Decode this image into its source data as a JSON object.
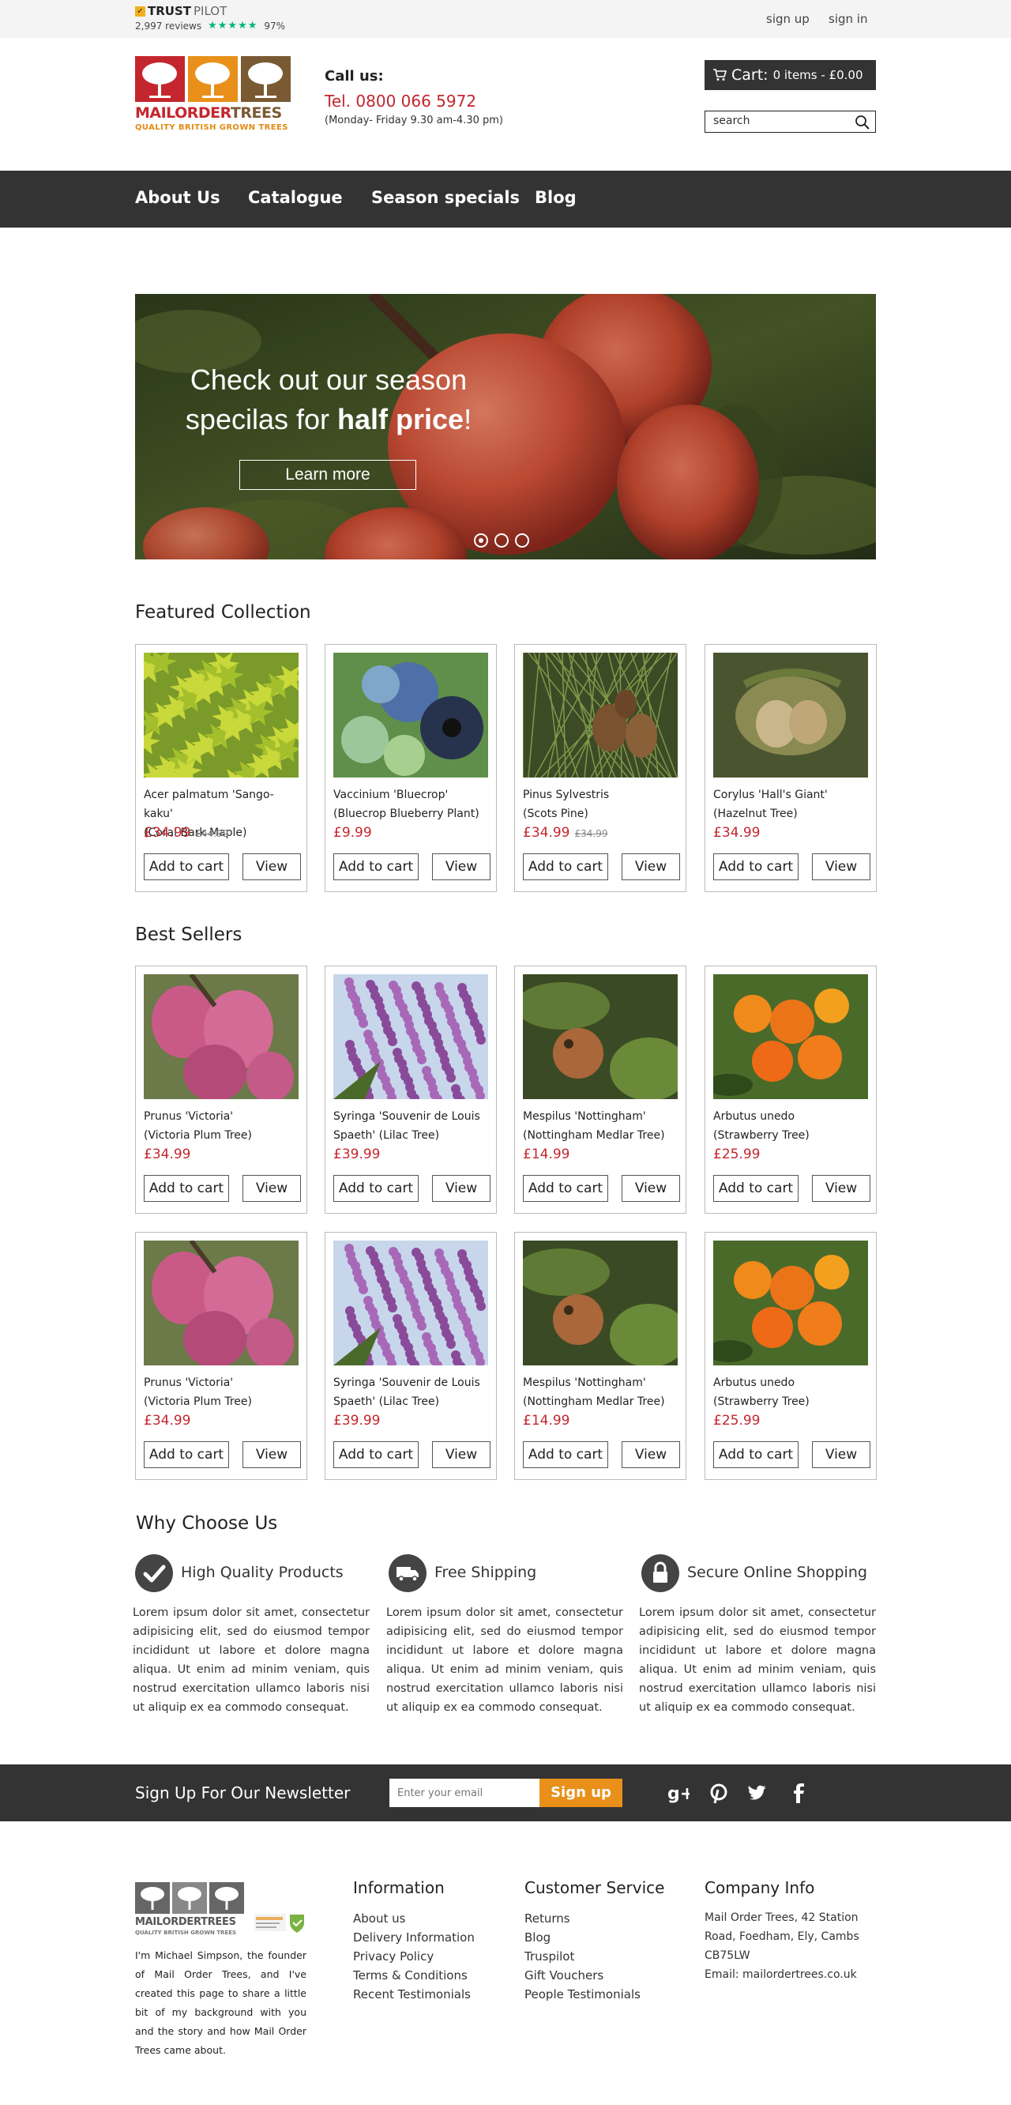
{
  "topbar": {
    "trustpilot_brand": "TRUST",
    "trustpilot_brand_light": "PILOT",
    "reviews": "2,997 reviews",
    "stars": "★★★★★",
    "rating": "97%",
    "signup": "sign up",
    "signin": "sign in"
  },
  "header": {
    "logo_mail": "MAILORDER",
    "logo_trees": "TREES",
    "logo_tagline": "QUALITY BRITISH GROWN TREES",
    "call_label": "Call us:",
    "phone": "Tel. 0800 066 5972",
    "hours": "(Monday- Friday 9.30 am-4.30 pm)",
    "cart_label": "Cart:",
    "cart_summary": "0 items - £0.00",
    "search_value": "search"
  },
  "nav": [
    "About Us",
    "Catalogue",
    "Season specials",
    "Blog"
  ],
  "hero": {
    "line1": "Check out our season",
    "line2_pre": "specilas for ",
    "line2_bold": "half price",
    "line2_post": "!",
    "cta": "Learn more",
    "slides": 3,
    "active_slide": 1
  },
  "featured": {
    "title": "Featured Collection",
    "products": [
      {
        "name1": "Acer palmatum 'Sango-kaku'",
        "name2": " (Coral Bark Maple)",
        "price": "£34.99",
        "old_price": "£44.99",
        "image": "acer"
      },
      {
        "name1": "Vaccinium 'Bluecrop'",
        "name2": "(Bluecrop Blueberry Plant)",
        "price": "£9.99",
        "old_price": "",
        "image": "blueberry"
      },
      {
        "name1": "Pinus Sylvestris",
        "name2": "(Scots Pine)",
        "price": " £34.99",
        "old_price": "£34.99",
        "image": "pine"
      },
      {
        "name1": "Corylus 'Hall's Giant'",
        "name2": "(Hazelnut Tree)",
        "price": " £34.99",
        "old_price": "",
        "image": "hazel"
      }
    ]
  },
  "bestsellers": {
    "title": "Best Sellers",
    "products": [
      {
        "name1": "Prunus 'Victoria'",
        "name2": "(Victoria Plum Tree)",
        "price": "£34.99",
        "old_price": "",
        "image": "plum"
      },
      {
        "name1": "Syringa 'Souvenir de Louis",
        "name2": "Spaeth' (Lilac Tree)",
        "price": "£39.99",
        "old_price": "",
        "image": "lilac"
      },
      {
        "name1": "Mespilus 'Nottingham'",
        "name2": "(Nottingham Medlar Tree)",
        "price": "£14.99",
        "old_price": "",
        "image": "medlar"
      },
      {
        "name1": "Arbutus unedo",
        "name2": "(Strawberry Tree)",
        "price": "£25.99",
        "old_price": "",
        "image": "arbutus"
      },
      {
        "name1": "Prunus 'Victoria'",
        "name2": "(Victoria Plum Tree)",
        "price": "£34.99",
        "old_price": "",
        "image": "plum"
      },
      {
        "name1": "Syringa 'Souvenir de Louis",
        "name2": "Spaeth' (Lilac Tree)",
        "price": "£39.99",
        "old_price": "",
        "image": "lilac"
      },
      {
        "name1": "Mespilus 'Nottingham'",
        "name2": "(Nottingham Medlar Tree)",
        "price": "£14.99",
        "old_price": "",
        "image": "medlar"
      },
      {
        "name1": "Arbutus unedo",
        "name2": "(Strawberry Tree)",
        "price": "£25.99",
        "old_price": "",
        "image": "arbutus"
      }
    ]
  },
  "buttons": {
    "add": "Add to cart",
    "view": "View"
  },
  "why": {
    "title": "Why Choose Us",
    "features": [
      {
        "icon": "check-icon",
        "title": "High Quality Products",
        "text": "Lorem ipsum dolor sit amet, consectetur adipisicing elit, sed do eiusmod tempor incididunt ut labore et dolore magna aliqua. Ut enim ad minim veniam, quis nostrud exercitation ullamco laboris nisi ut aliquip ex ea commodo consequat."
      },
      {
        "icon": "truck-icon",
        "title": "Free Shipping",
        "text": "Lorem ipsum dolor sit amet, consectetur adipisicing elit, sed do eiusmod tempor incididunt ut labore et dolore magna aliqua. Ut enim ad minim veniam, quis nostrud exercitation ullamco laboris nisi ut aliquip ex ea commodo consequat."
      },
      {
        "icon": "lock-icon",
        "title": "Secure Online Shopping",
        "text": "Lorem ipsum dolor sit amet, consectetur adipisicing elit, sed do eiusmod tempor incididunt ut labore et dolore magna aliqua. Ut enim ad minim veniam, quis nostrud exercitation ullamco laboris nisi ut aliquip ex ea commodo consequat."
      }
    ]
  },
  "newsletter": {
    "title": "Sign Up For Our Newsletter",
    "placeholder": "Enter your email",
    "button": "Sign up",
    "social": [
      "google-plus-icon",
      "pinterest-icon",
      "twitter-icon",
      "facebook-icon"
    ]
  },
  "footer": {
    "about": "I'm Michael Simpson, the founder of Mail Order Trees, and I've created this page to share a little bit of my background with you and the story and how Mail Order Trees came about.",
    "information": {
      "title": "Information",
      "links": [
        "About us",
        "Delivery Information",
        "Privacy Policy",
        "Terms & Conditions",
        "Recent Testimonials"
      ]
    },
    "customer_service": {
      "title": "Customer Service",
      "links": [
        "Returns",
        "Blog",
        "Truspilot",
        "Gift Vouchers",
        "People Testimonials"
      ]
    },
    "company": {
      "title": "Company Info",
      "address": "Mail Order Trees, 42 Station Road, Foedham, Ely, Cambs CB75LW",
      "email": "Email: mailordertrees.co.uk"
    }
  },
  "colors": {
    "accent_red": "#c4262e",
    "accent_orange": "#e8901a",
    "dark_bar": "#333333"
  }
}
